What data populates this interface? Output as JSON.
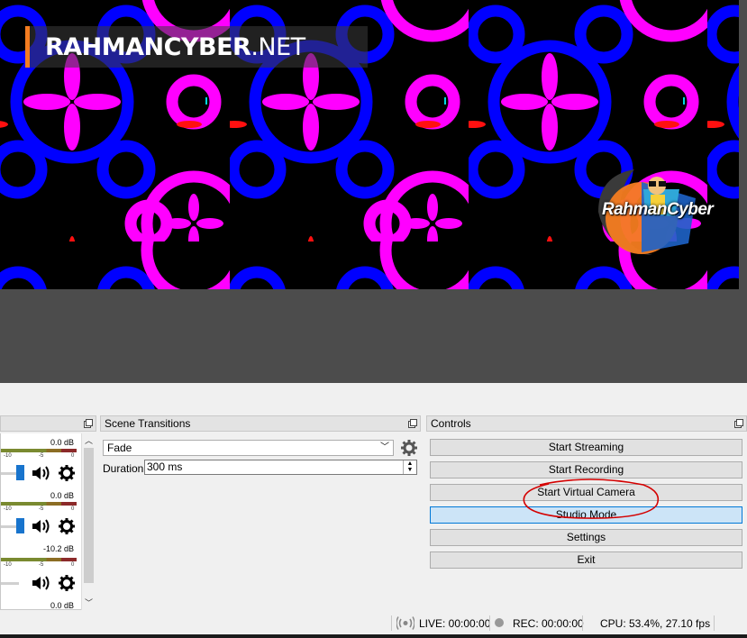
{
  "preview": {
    "watermark_main": "RAHMANCYBER",
    "watermark_suffix": ".NET",
    "logo_text": "RahmanCyber"
  },
  "mixer": {
    "channels": [
      {
        "db": "0.0 dB"
      },
      {
        "db": "0.0 dB"
      },
      {
        "db": "-10.2 dB"
      },
      {
        "db": "0.0 dB"
      }
    ],
    "ticks": [
      "-10",
      "-5",
      "0"
    ]
  },
  "transitions": {
    "title": "Scene Transitions",
    "selected": "Fade",
    "duration_label": "Duration",
    "duration_value": "300 ms"
  },
  "controls": {
    "title": "Controls",
    "buttons": [
      {
        "label": "Start Streaming"
      },
      {
        "label": "Start Recording"
      },
      {
        "label": "Start Virtual Camera"
      },
      {
        "label": "Studio Mode"
      },
      {
        "label": "Settings"
      },
      {
        "label": "Exit"
      }
    ]
  },
  "statusbar": {
    "live": "LIVE: 00:00:00",
    "rec": "REC: 00:00:00",
    "cpu": "CPU: 53.4%, 27.10 fps"
  },
  "colors": {
    "accent_orange": "#f47c20",
    "pattern_magenta": "#ff00ff",
    "pattern_blue": "#0000ff",
    "active_button": "#cce4f7",
    "annotation_red": "#d40000"
  }
}
